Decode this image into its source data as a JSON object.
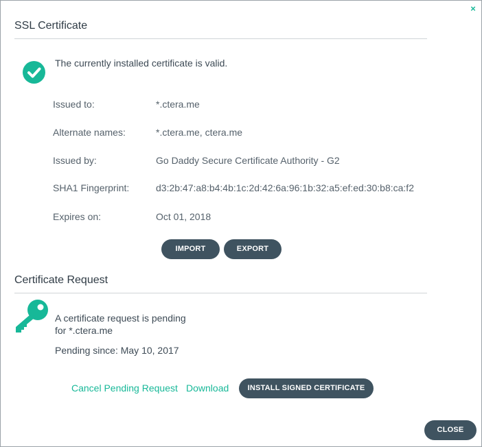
{
  "dialog": {
    "close_glyph": "×"
  },
  "ssl": {
    "title": "SSL Certificate",
    "status_icon": "check-circle-icon",
    "status_message": "The currently installed certificate is valid.",
    "details": [
      {
        "label": "Issued to:",
        "value": "*.ctera.me"
      },
      {
        "label": "Alternate names:",
        "value": "*.ctera.me, ctera.me"
      },
      {
        "label": "Issued by:",
        "value": "Go Daddy Secure Certificate Authority - G2"
      },
      {
        "label": "SHA1 Fingerprint:",
        "value": "d3:2b:47:a8:b4:4b:1c:2d:42:6a:96:1b:32:a5:ef:ed:30:b8:ca:f2"
      },
      {
        "label": "Expires on:",
        "value": "Oct 01, 2018"
      }
    ],
    "import_label": "IMPORT",
    "export_label": "EXPORT"
  },
  "request": {
    "title": "Certificate Request",
    "icon": "key-icon",
    "message_line1": "A certificate request is pending",
    "message_line2": "for *.ctera.me",
    "pending_since": "Pending since: May 10, 2017",
    "cancel_link": "Cancel Pending Request",
    "download_link": "Download",
    "install_label": "INSTALL SIGNED CERTIFICATE"
  },
  "footer": {
    "close_label": "CLOSE"
  },
  "colors": {
    "accent": "#17b898",
    "button": "#3f5360",
    "text": "#3d4a55"
  }
}
